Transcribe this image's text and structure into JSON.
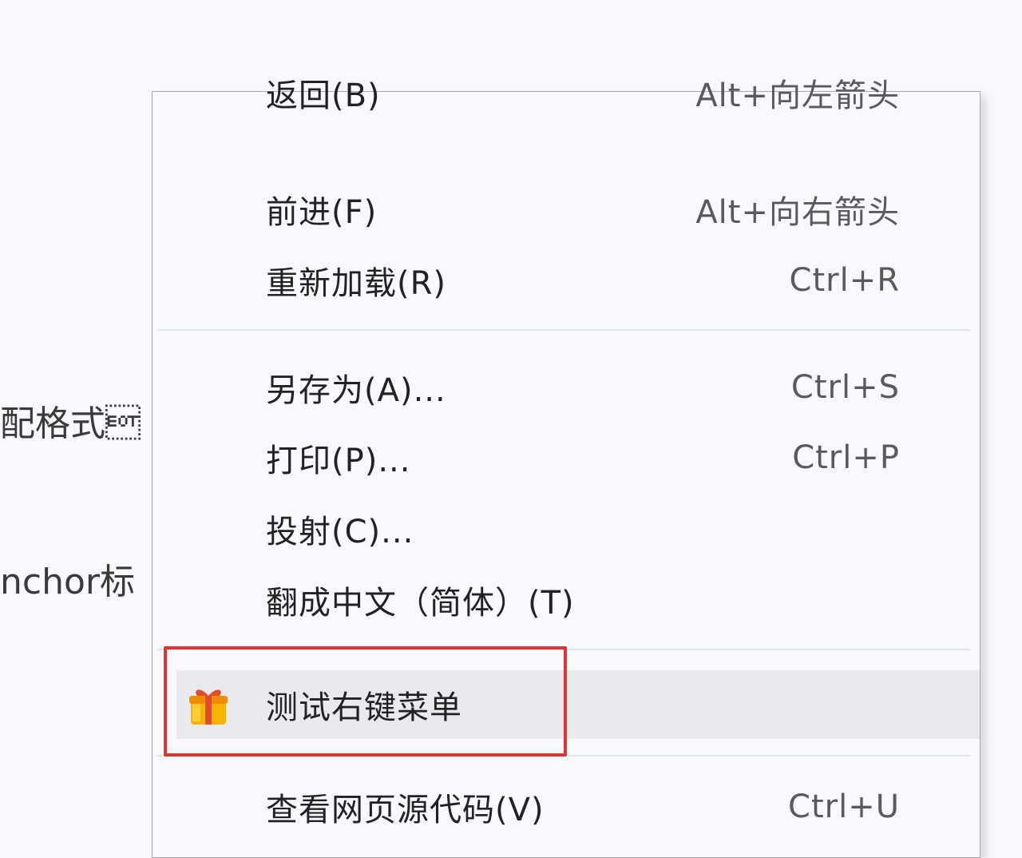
{
  "background": {
    "line1": "配格式\u0004",
    "line2": "nchor标"
  },
  "menu": {
    "items": [
      {
        "label": "返回(B)",
        "shortcut": "Alt+向左箭头"
      },
      {
        "label": "前进(F)",
        "shortcut": "Alt+向右箭头"
      },
      {
        "label": "重新加载(R)",
        "shortcut": "Ctrl+R"
      },
      {
        "label": "另存为(A)...",
        "shortcut": "Ctrl+S"
      },
      {
        "label": "打印(P)...",
        "shortcut": "Ctrl+P"
      },
      {
        "label": "投射(C)...",
        "shortcut": ""
      },
      {
        "label": "翻成中文（简体）(T)",
        "shortcut": ""
      },
      {
        "label": "测试右键菜单",
        "shortcut": "",
        "icon": "gift-icon"
      },
      {
        "label": "查看网页源代码(V)",
        "shortcut": "Ctrl+U"
      }
    ]
  },
  "colors": {
    "highlight_border": "#e03434",
    "highlight_bg": "#e9eaee",
    "menu_bg": "#f8f9fd"
  }
}
